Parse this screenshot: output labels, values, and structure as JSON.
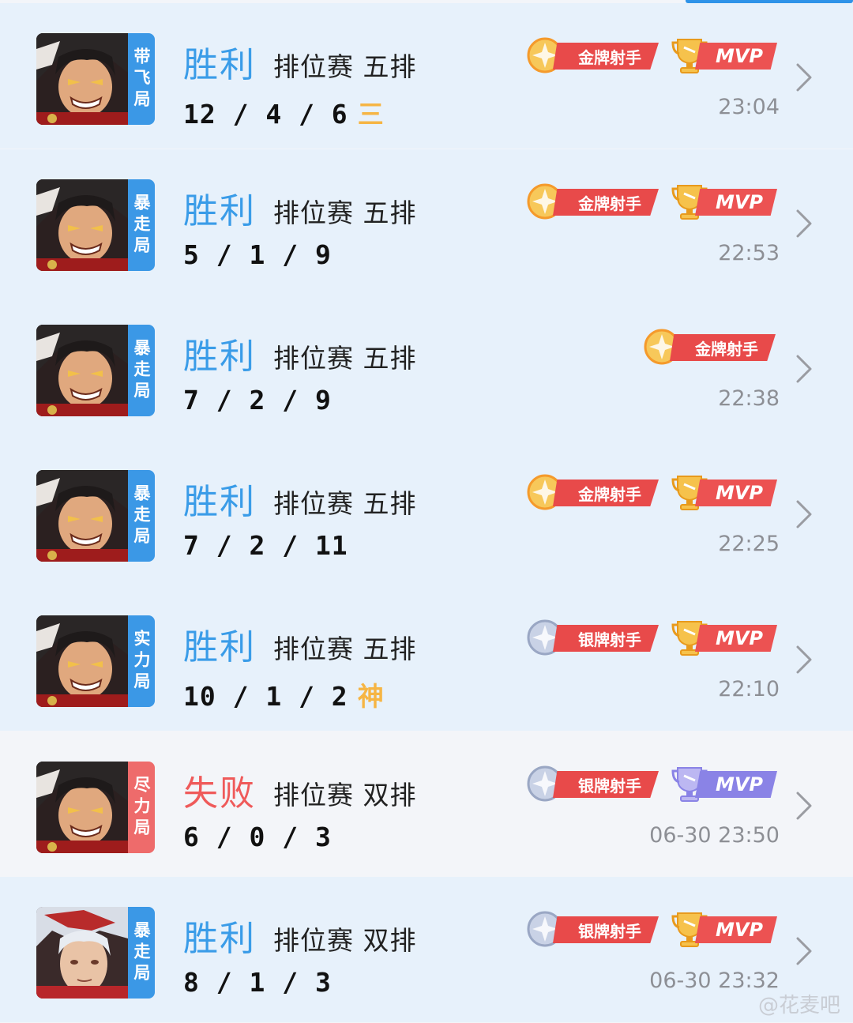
{
  "matches": [
    {
      "tag": "带飞局",
      "result": "胜利",
      "win": true,
      "mode": "排位赛 五排",
      "kda": "12 / 4 / 6",
      "mark": "三",
      "badges": [
        "金牌射手",
        "MVP"
      ],
      "medal": "gold",
      "mvp": "gold",
      "time": "23:04",
      "hero": "dark"
    },
    {
      "tag": "暴走局",
      "result": "胜利",
      "win": true,
      "mode": "排位赛 五排",
      "kda": "5 / 1 / 9",
      "mark": "",
      "badges": [
        "金牌射手",
        "MVP"
      ],
      "medal": "gold",
      "mvp": "gold",
      "time": "22:53",
      "hero": "dark"
    },
    {
      "tag": "暴走局",
      "result": "胜利",
      "win": true,
      "mode": "排位赛 五排",
      "kda": "7 / 2 / 9",
      "mark": "",
      "badges": [
        "金牌射手"
      ],
      "medal": "gold",
      "mvp": "",
      "time": "22:38",
      "hero": "dark"
    },
    {
      "tag": "暴走局",
      "result": "胜利",
      "win": true,
      "mode": "排位赛 五排",
      "kda": "7 / 2 / 11",
      "mark": "",
      "badges": [
        "金牌射手",
        "MVP"
      ],
      "medal": "gold",
      "mvp": "gold",
      "time": "22:25",
      "hero": "dark"
    },
    {
      "tag": "实力局",
      "result": "胜利",
      "win": true,
      "mode": "排位赛 五排",
      "kda": "10 / 1 / 2",
      "mark": "神",
      "badges": [
        "银牌射手",
        "MVP"
      ],
      "medal": "silver",
      "mvp": "gold",
      "time": "22:10",
      "hero": "dark"
    },
    {
      "tag": "尽力局",
      "result": "失败",
      "win": false,
      "mode": "排位赛 双排",
      "kda": "6 / 0 / 3",
      "mark": "",
      "badges": [
        "银牌射手",
        "MVP"
      ],
      "medal": "silver",
      "mvp": "silver",
      "time": "06-30 23:50",
      "hero": "dark"
    },
    {
      "tag": "暴走局",
      "result": "胜利",
      "win": true,
      "mode": "排位赛 双排",
      "kda": "8 / 1 / 3",
      "mark": "",
      "badges": [
        "银牌射手",
        "MVP"
      ],
      "medal": "silver",
      "mvp": "gold",
      "time": "06-30 23:32",
      "hero": "light"
    }
  ],
  "watermark": "@花麦吧",
  "colors": {
    "win": "#3a9ce8",
    "lose": "#ef5a5a",
    "winRowBg": "#e7f1fb",
    "tagWin": "#3b98e6",
    "tagLose": "#ee6b6b",
    "badgeRed": "#e84a4a",
    "mvpSilver": "#8a83e6"
  },
  "icons": {
    "avatar": "hero-portrait",
    "medal": "shooter-medal-icon",
    "trophy": "mvp-trophy-icon",
    "chevron": "chevron-right-icon"
  }
}
